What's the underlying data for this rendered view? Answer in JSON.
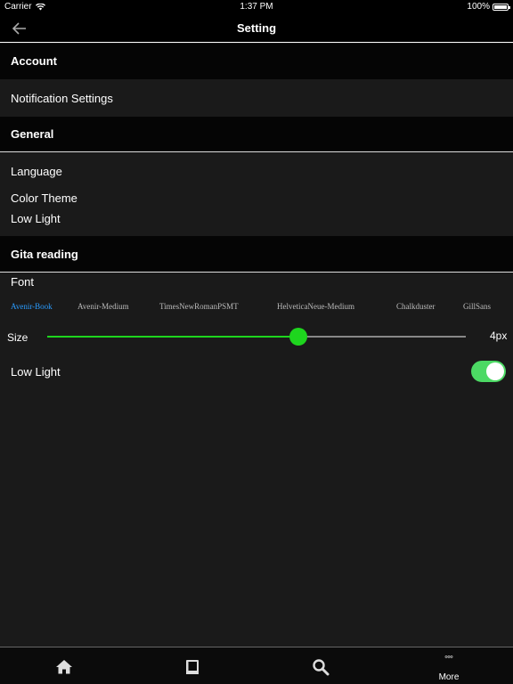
{
  "status_bar": {
    "carrier": "Carrier",
    "time": "1:37 PM",
    "battery": "100%"
  },
  "nav": {
    "title": "Setting",
    "back_icon": "arrow-left-icon"
  },
  "sections": {
    "account": {
      "title": "Account",
      "items": [
        "Notification Settings"
      ]
    },
    "general": {
      "title": "General",
      "items": [
        "Language",
        "Color Theme",
        "Low Light"
      ]
    },
    "gita_reading": {
      "title": "Gita reading",
      "font_label": "Font",
      "fonts": [
        "Avenir-Book",
        "Avenir-Medium",
        "TimesNewRomanPSMT",
        "HelveticaNeue-Medium",
        "Chalkduster",
        "GillSans"
      ],
      "selected_font": "Avenir-Book",
      "size_label": "Size",
      "size_value": "4px",
      "size_fraction": 0.6,
      "low_light_label": "Low Light",
      "low_light_on": true
    }
  },
  "colors": {
    "accent": "#1ed51e",
    "toggle_on": "#4cd964",
    "selected_font": "#2a9cff"
  },
  "tab_bar": {
    "tabs": [
      {
        "icon": "home-icon"
      },
      {
        "icon": "book-icon"
      },
      {
        "icon": "search-icon"
      },
      {
        "icon": "more-icon",
        "label": "More"
      }
    ]
  }
}
